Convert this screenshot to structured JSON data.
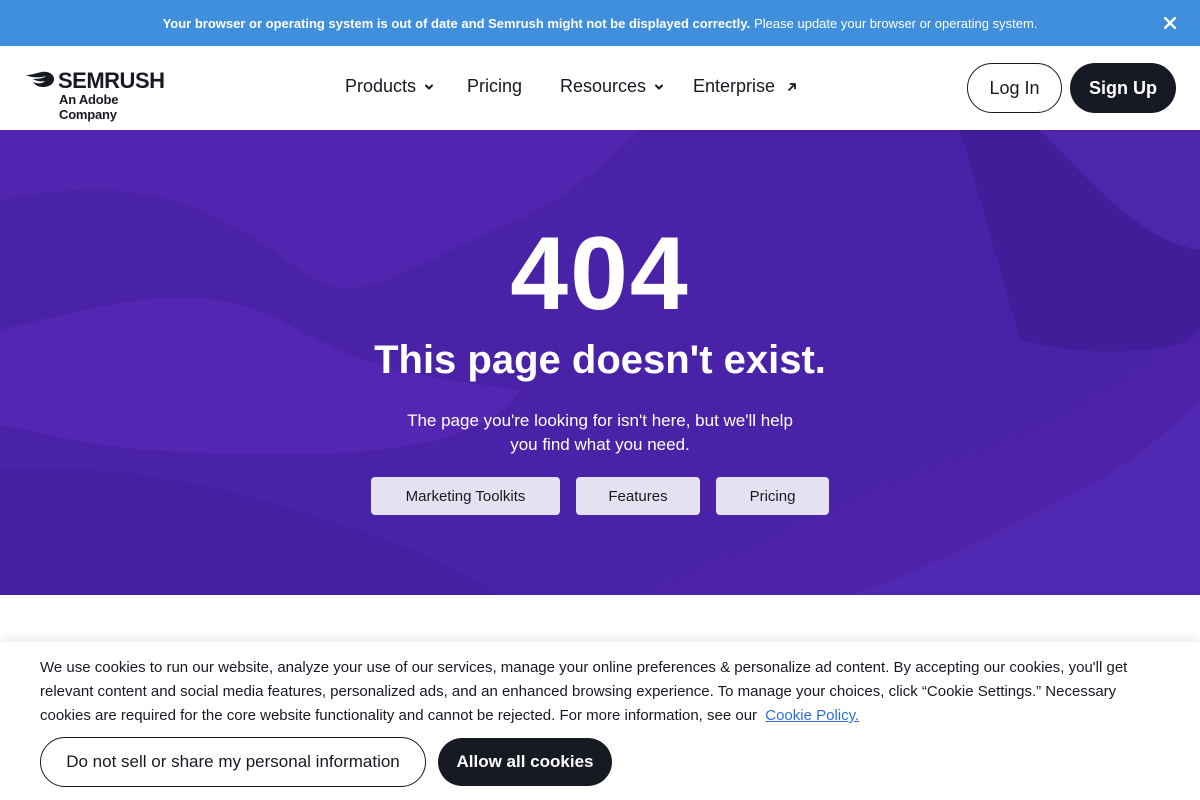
{
  "banner": {
    "bold_text": "Your browser or operating system is out of date and Semrush might not be displayed correctly.",
    "text": "Please update your browser or operating system.",
    "close_icon": "close-icon"
  },
  "logo": {
    "wordmark": "SEMRUSH",
    "tagline": "An Adobe Company",
    "icon": "semrush-fireball-icon"
  },
  "nav": {
    "products": "Products",
    "pricing": "Pricing",
    "resources": "Resources",
    "enterprise": "Enterprise",
    "chevron_icon": "chevron-down-icon",
    "external_icon": "arrow-up-right-icon"
  },
  "header": {
    "login_label": "Log In",
    "signup_label": "Sign Up"
  },
  "hero": {
    "code": "404",
    "title": "This page doesn't exist.",
    "text_line1": "The page you're looking for isn't here, but we'll help",
    "text_line2": "you find what you need.",
    "buttons": [
      "Marketing Toolkits",
      "Features",
      "Pricing"
    ],
    "background_color": "#4a22a8"
  },
  "cookie": {
    "text": "We use cookies to run our website, analyze your use of our services, manage your online preferences & personalize ad content. By accepting our cookies, you'll get relevant content and social media features, personalized ads, and an enhanced browsing experience. To manage your choices, click “Cookie Settings.” Necessary cookies are required for the core website functionality and cannot be rejected. For more information, see our",
    "link_label": "Cookie Policy.",
    "do_not_sell_label": "Do not sell or share my personal information",
    "allow_label": "Allow all cookies"
  },
  "colors": {
    "banner": "#3f8fdc",
    "hero": "#4a22a8",
    "dark": "#171a22",
    "hero_button": "#e4e1f1",
    "link": "#2f6fdc"
  }
}
